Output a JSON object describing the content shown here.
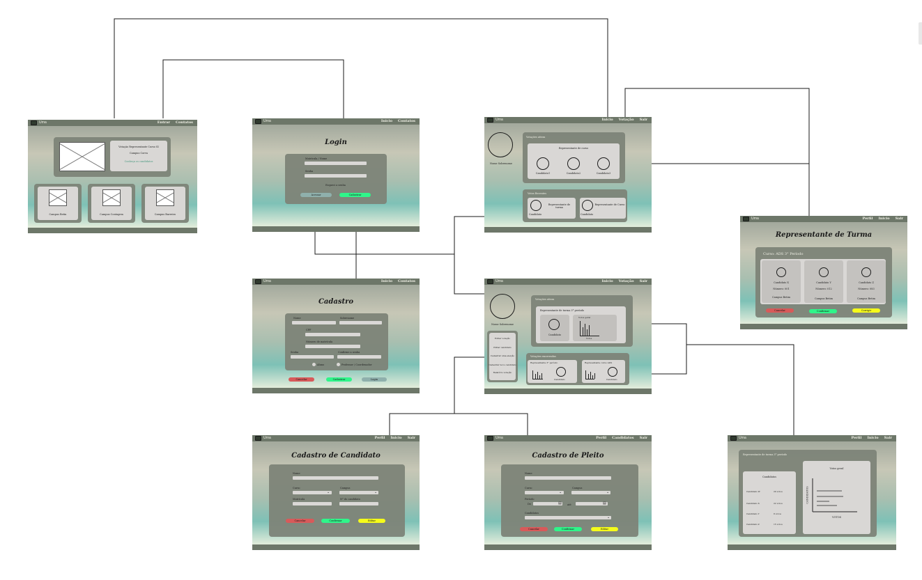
{
  "app_name": "Urna",
  "s1": {
    "nav": [
      "Entrar",
      "Contatos"
    ],
    "banner_title": "Votação Representante Curso SI",
    "banner_campus": "Campus Corva",
    "banner_link": "Conheça os candidatos",
    "campus": [
      "Campus Betin",
      "Campus Contagem",
      "Campus Barreiro"
    ]
  },
  "s2": {
    "nav": [
      "Inicio",
      "Contatos"
    ],
    "title": "Login",
    "field1": "Matrícula / Nome",
    "field2": "Senha",
    "forgot": "Esqueci a senha",
    "btn_enter": "Acessar",
    "btn_register": "Cadastrar"
  },
  "s3": {
    "nav": [
      "Inicio",
      "Votação",
      "Sair"
    ],
    "user": "Nome Sobrenome",
    "active_title": "Votações ativas",
    "card_title": "Representante de curso",
    "candidates": [
      "Candidato1",
      "Candidato2",
      "Candidato3"
    ],
    "recent_title": "Votos Recentes",
    "recent": [
      "Representante de turma",
      "Representante de Curso"
    ],
    "recent_cand": [
      "Candidato",
      "Candidato"
    ]
  },
  "s4": {
    "nav": [
      "Perfil",
      "Inicio",
      "Sair"
    ],
    "title": "Representante de Turma",
    "course": "Curso: ADS 3° Período",
    "cards": [
      {
        "name": "Candidato X",
        "num": "Número: 001",
        "campus": "Campus Betim"
      },
      {
        "name": "Candidato Y",
        "num": "Número: 012",
        "campus": "Campus Betim"
      },
      {
        "name": "Candidato Z",
        "num": "Número: 083",
        "campus": "Campus Betim"
      }
    ],
    "btn_cancel": "Cancelar",
    "btn_confirm": "Confirmar",
    "btn_fix": "Corrigir"
  },
  "s5": {
    "nav": [
      "Inicio",
      "Contatos"
    ],
    "title": "Cadastro",
    "labels": [
      "Nome",
      "Sobrenome",
      "CPF",
      "Número de matrícula",
      "Senha",
      "Confirme a senha"
    ],
    "radio1": "Aluno",
    "radio2": "Professor / Coordenador",
    "btn_cancel": "Cancelar",
    "btn_register": "Cadastrar",
    "btn_login": "Login"
  },
  "s6": {
    "nav": [
      "Inicio",
      "Votação",
      "Sair"
    ],
    "user": "Nome Sobrenome",
    "menu": [
      "Editar votação",
      "Editar candidato",
      "Cadastrar uma eleição",
      "Cadastrar novo candidato",
      "Relatório votação"
    ],
    "active_title": "Votações ativas",
    "card_title": "Representante de turma 3° período",
    "candidate": "Candidato",
    "votes_title": "Votos geral",
    "votes_axis": "Votos",
    "ended_title": "Votações encerradas",
    "ended": [
      "Representante 3° período",
      "Representante curso ADS"
    ],
    "ended_cand": [
      "Candidato",
      "Candidato"
    ]
  },
  "s7": {
    "nav": [
      "Perfil",
      "Inicio",
      "Sair"
    ],
    "title": "Cadastro de Candidato",
    "labels": [
      "Nome",
      "Curso",
      "Campus",
      "Matrícula",
      "N° do candidato"
    ],
    "btn_cancel": "Cancelar",
    "btn_confirm": "Confirmar",
    "btn_edit": "Editar"
  },
  "s8": {
    "nav": [
      "Perfil",
      "Candidatos",
      "Sair"
    ],
    "title": "Cadastro de Pleito",
    "labels": [
      "Nome",
      "Curso",
      "Campus",
      "Período",
      "De",
      "até",
      "Candidatos"
    ],
    "btn_cancel": "Cancelar",
    "btn_confirm": "Confirmar",
    "btn_edit": "Editar"
  },
  "s9": {
    "nav": [
      "Perfil",
      "Inicio",
      "Sair"
    ],
    "header": "Representante de turma 3° período",
    "cand_title": "Candidatos",
    "rows": [
      {
        "name": "Candidato W",
        "votes": "20 votos"
      },
      {
        "name": "Candidato X",
        "votes": "22 votos"
      },
      {
        "name": "Candidato Y",
        "votes": "8 votos"
      },
      {
        "name": "Candidato Z",
        "votes": "15 votos"
      }
    ],
    "votes_title": "Votos geral",
    "y_label": "CANDIDATOS",
    "x_label": "VOTOS"
  }
}
